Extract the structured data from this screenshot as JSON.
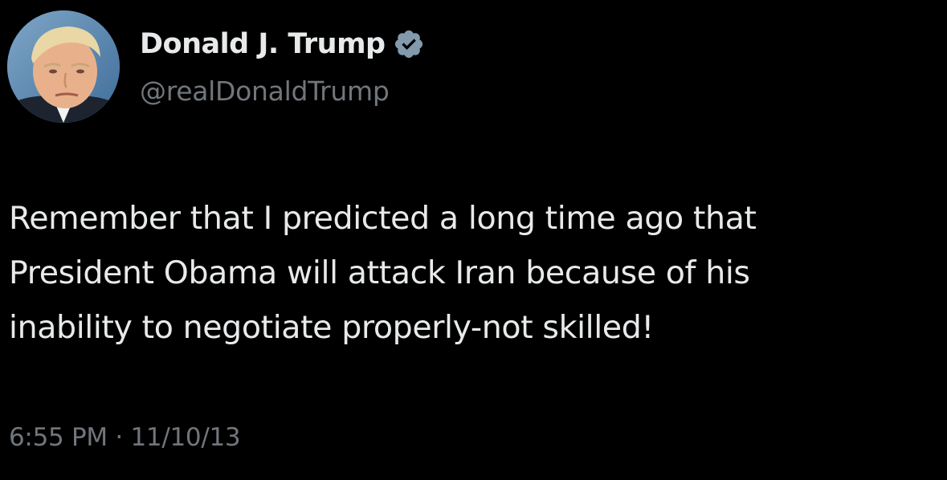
{
  "tweet": {
    "author": {
      "display_name": "Donald J. Trump",
      "handle": "@realDonaldTrump",
      "verified": true,
      "avatar": "profile-photo"
    },
    "text": "Remember that I predicted a long time ago that\nPresident Obama will attack Iran because of his\ninability to negotiate properly-not skilled!",
    "time": "6:55 PM",
    "separator": "·",
    "date": "11/10/13"
  },
  "colors": {
    "background": "#000000",
    "primary_text": "#e7e9ea",
    "secondary_text": "#71767b",
    "verified_badge": "#829aab"
  },
  "icons": {
    "verified": "verified-badge-icon"
  }
}
